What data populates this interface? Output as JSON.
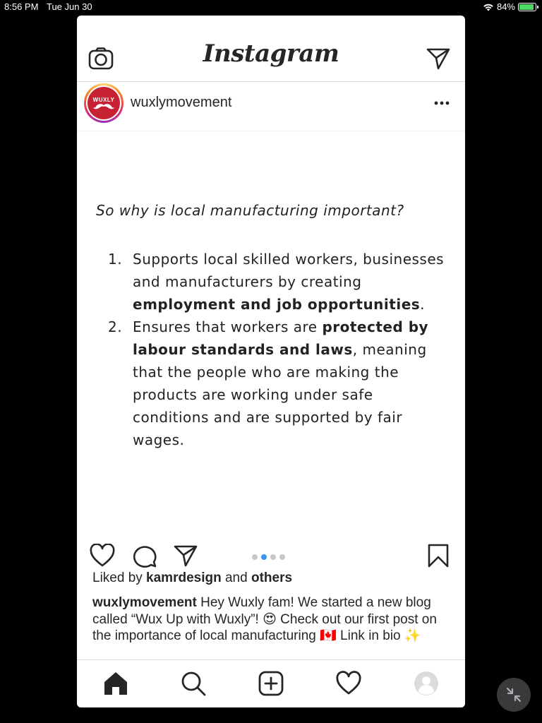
{
  "status_bar": {
    "time": "8:56 PM",
    "date": "Tue Jun 30",
    "battery": "84%"
  },
  "nav": {
    "logo": "Instagram"
  },
  "post": {
    "username": "wuxlymovement",
    "avatar_text": "WUXLY",
    "image": {
      "question": "So why is local manufacturing important?",
      "items": [
        {
          "number": "1.",
          "text_a": "Supports local skilled workers, businesses and manufacturers by creating ",
          "bold_a": "employment and job opportunities",
          "text_b": "."
        },
        {
          "number": "2.",
          "text_a": "Ensures that workers are ",
          "bold_a": "protected by labour standards and laws",
          "text_b": ", meaning that the people who are making the products are working under safe conditions and are supported by fair wages."
        }
      ]
    },
    "carousel": {
      "total": 4,
      "active_index": 1
    },
    "likes": {
      "prefix": "Liked by ",
      "user": "kamrdesign",
      "middle": " and ",
      "others": "others"
    },
    "caption": {
      "username": "wuxlymovement",
      "text": " Hey Wuxly fam! We started a new blog called “Wux Up with Wuxly”! 😍 Check out our first post on the importance of local manufacturing 🇨🇦 Link in bio ✨"
    }
  },
  "colors": {
    "accent_blue": "#3897f0",
    "brand_red": "#c62233",
    "battery_green": "#4cd964"
  },
  "icons": [
    "camera-icon",
    "direct-send-icon",
    "more-options-icon",
    "heart-icon",
    "comment-icon",
    "share-icon",
    "bookmark-icon",
    "home-icon",
    "search-icon",
    "new-post-icon",
    "activity-heart-icon",
    "profile-icon",
    "minimize-icon",
    "wifi-icon",
    "battery-icon"
  ]
}
